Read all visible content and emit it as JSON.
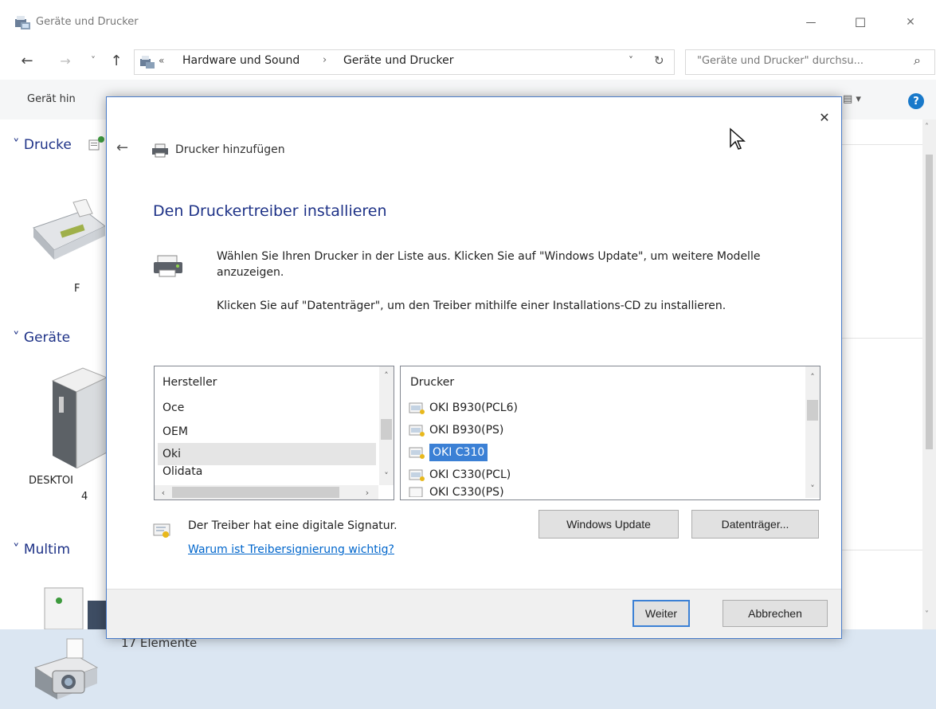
{
  "window": {
    "title": "Geräte und Drucker",
    "min_glyph": "—",
    "max_glyph": "☐",
    "close_glyph": "✕"
  },
  "addressbar": {
    "back_glyph": "←",
    "forward_glyph": "→",
    "recent_glyph": "˅",
    "up_glyph": "↑",
    "overflow_glyph": "«",
    "crumb1": "Hardware und Sound",
    "crumb_sep": "›",
    "crumb2": "Geräte und Drucker",
    "dropdown_glyph": "˅",
    "refresh_glyph": "↻",
    "search_placeholder": "\"Geräte und Drucker\" durchsu...",
    "search_glyph": "⌕"
  },
  "cmdbar": {
    "add_device": "Gerät hin",
    "view_glyph": "▤ ▾",
    "help_glyph": "?"
  },
  "groups": {
    "printers": "Drucke",
    "devices": "Geräte",
    "multimedia": "Multim",
    "fax_label": "F",
    "desktop_label": "DESKTOI",
    "desktop_label2": "4"
  },
  "status": {
    "count": "17 Elemente"
  },
  "dialog": {
    "close_glyph": "✕",
    "back_glyph": "←",
    "nav_title": "Drucker hinzufügen",
    "heading": "Den Druckertreiber installieren",
    "desc1": "Wählen Sie Ihren Drucker in der Liste aus. Klicken Sie auf \"Windows Update\", um weitere Modelle anzuzeigen.",
    "desc2": "Klicken Sie auf \"Datenträger\", um den Treiber mithilfe einer Installations-CD zu installieren.",
    "manufacturer_header": "Hersteller",
    "manufacturers": [
      "Oce",
      "OEM",
      "Oki",
      "Olidata"
    ],
    "printer_header": "Drucker",
    "printers": [
      "OKI B930(PCL6)",
      "OKI B930(PS)",
      "OKI C310",
      "OKI C330(PCL)",
      "OKI C330(PS)"
    ],
    "selected_manufacturer": "Oki",
    "selected_printer": "OKI C310",
    "signature_text": "Der Treiber hat eine digitale Signatur.",
    "signature_link": "Warum ist Treibersignierung wichtig?",
    "windows_update_button": "Windows Update",
    "disk_button": "Datenträger...",
    "next_button": "Weiter",
    "cancel_button": "Abbrechen"
  },
  "colors": {
    "selection": "#3b80d5",
    "dialog_border": "#4a7cc9",
    "heading": "#1e3287",
    "link": "#0066cc"
  }
}
